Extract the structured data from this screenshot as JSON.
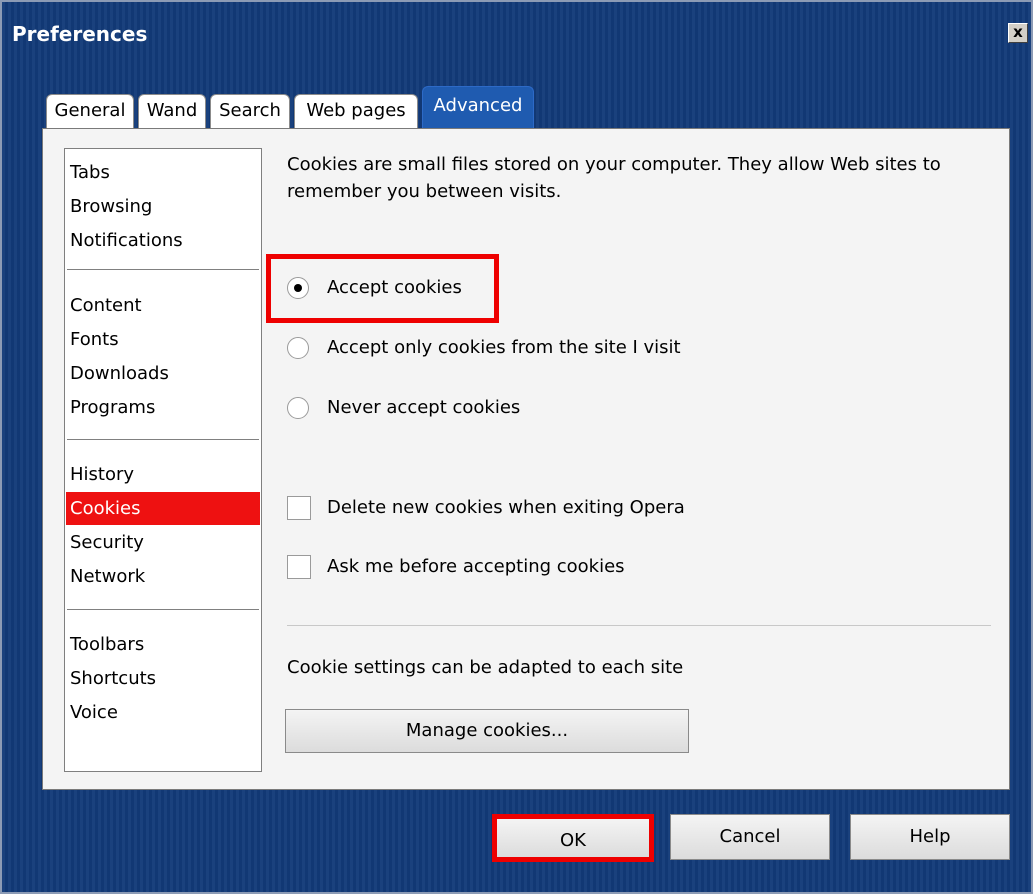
{
  "window": {
    "title": "Preferences",
    "close_label": "x"
  },
  "tabs": [
    {
      "label": "General",
      "active": false
    },
    {
      "label": "Wand",
      "active": false
    },
    {
      "label": "Search",
      "active": false
    },
    {
      "label": "Web pages",
      "active": false
    },
    {
      "label": "Advanced",
      "active": true
    }
  ],
  "sidebar": {
    "groups": [
      [
        "Tabs",
        "Browsing",
        "Notifications"
      ],
      [
        "Content",
        "Fonts",
        "Downloads",
        "Programs"
      ],
      [
        "History",
        "Cookies",
        "Security",
        "Network"
      ],
      [
        "Toolbars",
        "Shortcuts",
        "Voice"
      ]
    ],
    "selected": "Cookies"
  },
  "content": {
    "description": "Cookies are small files stored on your computer. They allow Web sites to remember you between visits.",
    "radios": [
      {
        "label": "Accept cookies",
        "checked": true
      },
      {
        "label": "Accept only cookies from the site I visit",
        "checked": false
      },
      {
        "label": "Never accept cookies",
        "checked": false
      }
    ],
    "checkboxes": [
      {
        "label": "Delete new cookies when exiting Opera",
        "checked": false
      },
      {
        "label": "Ask me before accepting cookies",
        "checked": false
      }
    ],
    "site_settings_text": "Cookie settings can be adapted to each site",
    "manage_button": "Manage cookies..."
  },
  "footer": {
    "ok": "OK",
    "cancel": "Cancel",
    "help": "Help"
  },
  "colors": {
    "highlight": "#ee0000",
    "selection": "#ee1111",
    "title_bar": "#123a78",
    "active_tab": "#1f5bb0"
  }
}
